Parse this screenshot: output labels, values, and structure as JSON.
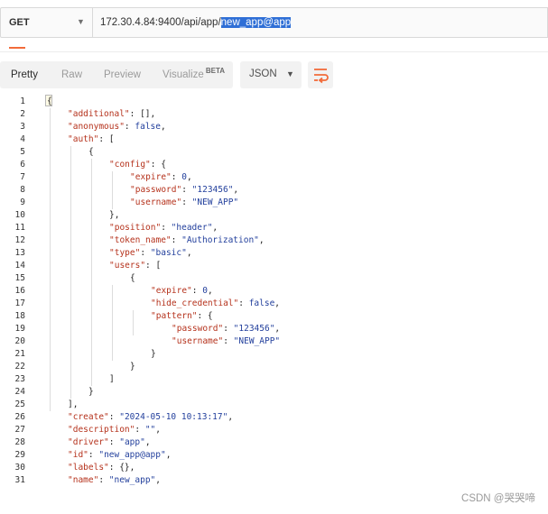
{
  "request": {
    "method": "GET",
    "url_prefix": "172.30.4.84:9400/api/app/",
    "url_selected": "new_app@app"
  },
  "toolbar": {
    "pretty": "Pretty",
    "raw": "Raw",
    "preview": "Preview",
    "visualize": "Visualize",
    "beta": "BETA",
    "format": "JSON",
    "wrap_icon": "wrap-lines-icon"
  },
  "code": {
    "line_numbers": [
      "1",
      "2",
      "3",
      "4",
      "5",
      "6",
      "7",
      "8",
      "9",
      "10",
      "11",
      "12",
      "13",
      "14",
      "15",
      "16",
      "17",
      "18",
      "19",
      "20",
      "21",
      "22",
      "23",
      "24",
      "25",
      "26",
      "27",
      "28",
      "29",
      "30",
      "31"
    ],
    "lines": [
      "{",
      "\"additional\": [],",
      "\"anonymous\": false,",
      "\"auth\": [",
      "{",
      "\"config\": {",
      "\"expire\": 0,",
      "\"password\": \"123456\",",
      "\"username\": \"NEW_APP\"",
      "},",
      "\"position\": \"header\",",
      "\"token_name\": \"Authorization\",",
      "\"type\": \"basic\",",
      "\"users\": [",
      "{",
      "\"expire\": 0,",
      "\"hide_credential\": false,",
      "\"pattern\": {",
      "\"password\": \"123456\",",
      "\"username\": \"NEW_APP\"",
      "}",
      "}",
      "]",
      "}",
      "],",
      "\"create\": \"2024-05-10 10:13:17\",",
      "\"description\": \"\",",
      "\"driver\": \"app\",",
      "\"id\": \"new_app@app\",",
      "\"labels\": {},",
      "\"name\": \"new_app\","
    ]
  },
  "watermark": "CSDN @哭哭啼"
}
